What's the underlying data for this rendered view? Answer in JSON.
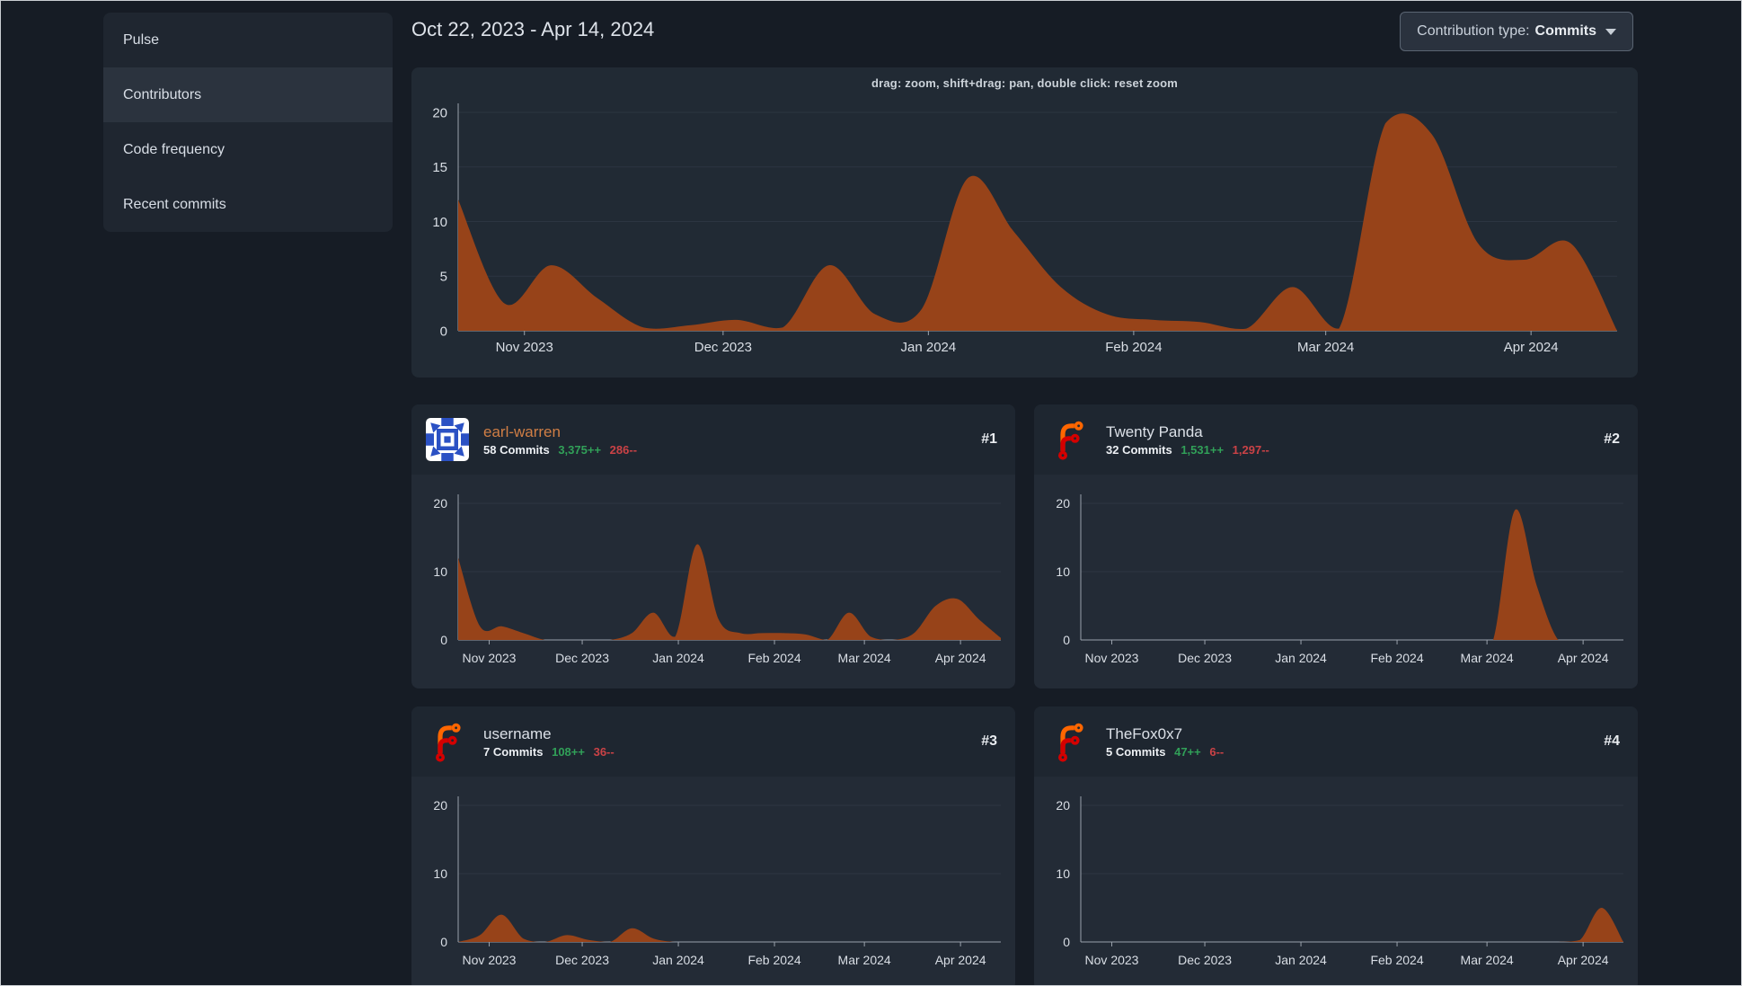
{
  "header": {
    "date_range": "Oct 22, 2023 - Apr 14, 2024",
    "contribution_type_label": "Contribution type:",
    "contribution_type_value": "Commits"
  },
  "sidebar": {
    "items": [
      {
        "label": "Pulse",
        "active": false
      },
      {
        "label": "Contributors",
        "active": true
      },
      {
        "label": "Code frequency",
        "active": false
      },
      {
        "label": "Recent commits",
        "active": false
      }
    ]
  },
  "colors": {
    "area": "#974319",
    "gridline": "#2c3541",
    "axis": "#9aa2ac",
    "tick_text": "#d9dee5",
    "green": "#31a058",
    "red": "#ca4246",
    "link_orange": "#d07e45",
    "forgejo_orange": "#ff6600",
    "forgejo_red": "#d40000",
    "identicon_blue": "#2b51c4"
  },
  "contributors": [
    {
      "rank": "#1",
      "name": "earl-warren",
      "commits": "58 Commits",
      "additions": "3,375++",
      "deletions": "286--",
      "avatar": "identicon"
    },
    {
      "rank": "#2",
      "name": "Twenty Panda",
      "commits": "32 Commits",
      "additions": "1,531++",
      "deletions": "1,297--",
      "avatar": "forgejo-logo"
    },
    {
      "rank": "#3",
      "name": "username",
      "commits": "7 Commits",
      "additions": "108++",
      "deletions": "36--",
      "avatar": "forgejo-logo"
    },
    {
      "rank": "#4",
      "name": "TheFox0x7",
      "commits": "5 Commits",
      "additions": "47++",
      "deletions": "6--",
      "avatar": "forgejo-logo"
    }
  ],
  "chart_data": [
    {
      "id": "overall-activity",
      "type": "area",
      "title": "drag: zoom, shift+drag: pan, double click: reset zoom",
      "x": [
        "2023-10-22",
        "2023-10-29",
        "2023-11-05",
        "2023-11-12",
        "2023-11-19",
        "2023-11-26",
        "2023-12-03",
        "2023-12-10",
        "2023-12-17",
        "2023-12-24",
        "2023-12-31",
        "2024-01-07",
        "2024-01-14",
        "2024-01-21",
        "2024-01-28",
        "2024-02-04",
        "2024-02-11",
        "2024-02-18",
        "2024-02-25",
        "2024-03-03",
        "2024-03-10",
        "2024-03-17",
        "2024-03-24",
        "2024-03-31",
        "2024-04-07",
        "2024-04-14"
      ],
      "values": [
        12,
        2.5,
        6,
        3,
        0.3,
        0.5,
        1,
        0.3,
        6,
        1.5,
        2,
        14,
        9,
        4,
        1.5,
        1,
        0.8,
        0.2,
        4,
        0.2,
        19,
        18,
        8,
        6.5,
        8,
        0
      ],
      "ylim": [
        0,
        20
      ],
      "yticks": [
        0,
        5,
        10,
        15,
        20
      ],
      "xticks": [
        "Nov 2023",
        "Dec 2023",
        "Jan 2024",
        "Feb 2024",
        "Mar 2024",
        "Apr 2024"
      ],
      "grid": true,
      "legend": "none"
    },
    {
      "id": "earl-warren-activity",
      "type": "area",
      "title": "",
      "values": [
        12,
        2,
        2,
        1,
        0,
        0,
        0,
        0,
        1,
        4,
        0.5,
        14,
        3,
        1,
        1,
        1,
        0.8,
        0,
        4,
        0.5,
        0,
        1,
        5,
        6,
        3,
        0.3
      ],
      "ylim": [
        0,
        20
      ],
      "yticks": [
        0,
        10,
        20
      ],
      "xticks": [
        "Nov 2023",
        "Dec 2023",
        "Jan 2024",
        "Feb 2024",
        "Mar 2024",
        "Apr 2024"
      ],
      "grid": true,
      "legend": "none"
    },
    {
      "id": "twenty-panda-activity",
      "type": "area",
      "title": "",
      "values": [
        0,
        0,
        0,
        0,
        0,
        0,
        0,
        0,
        0,
        0,
        0,
        0,
        0,
        0,
        0,
        0,
        0,
        0,
        0,
        0,
        19,
        8,
        0,
        0,
        0,
        0
      ],
      "ylim": [
        0,
        20
      ],
      "yticks": [
        0,
        10,
        20
      ],
      "xticks": [
        "Nov 2023",
        "Dec 2023",
        "Jan 2024",
        "Feb 2024",
        "Mar 2024",
        "Apr 2024"
      ],
      "grid": true,
      "legend": "none"
    },
    {
      "id": "username-activity",
      "type": "area",
      "title": "",
      "values": [
        0,
        1,
        4,
        0.5,
        0,
        1,
        0.3,
        0,
        2,
        0.5,
        0,
        0,
        0,
        0,
        0,
        0,
        0,
        0,
        0,
        0,
        0,
        0,
        0,
        0,
        0,
        0
      ],
      "ylim": [
        0,
        20
      ],
      "yticks": [
        0,
        10,
        20
      ],
      "xticks": [
        "Nov 2023",
        "Dec 2023",
        "Jan 2024",
        "Feb 2024",
        "Mar 2024",
        "Apr 2024"
      ],
      "grid": true,
      "legend": "none"
    },
    {
      "id": "thefox0x7-activity",
      "type": "area",
      "title": "",
      "values": [
        0,
        0,
        0,
        0,
        0,
        0,
        0,
        0,
        0,
        0,
        0,
        0,
        0,
        0,
        0,
        0,
        0,
        0,
        0,
        0,
        0,
        0,
        0,
        0.3,
        5,
        0
      ],
      "ylim": [
        0,
        20
      ],
      "yticks": [
        0,
        10,
        20
      ],
      "xticks": [
        "Nov 2023",
        "Dec 2023",
        "Jan 2024",
        "Feb 2024",
        "Mar 2024",
        "Apr 2024"
      ],
      "grid": true,
      "legend": "none"
    }
  ]
}
